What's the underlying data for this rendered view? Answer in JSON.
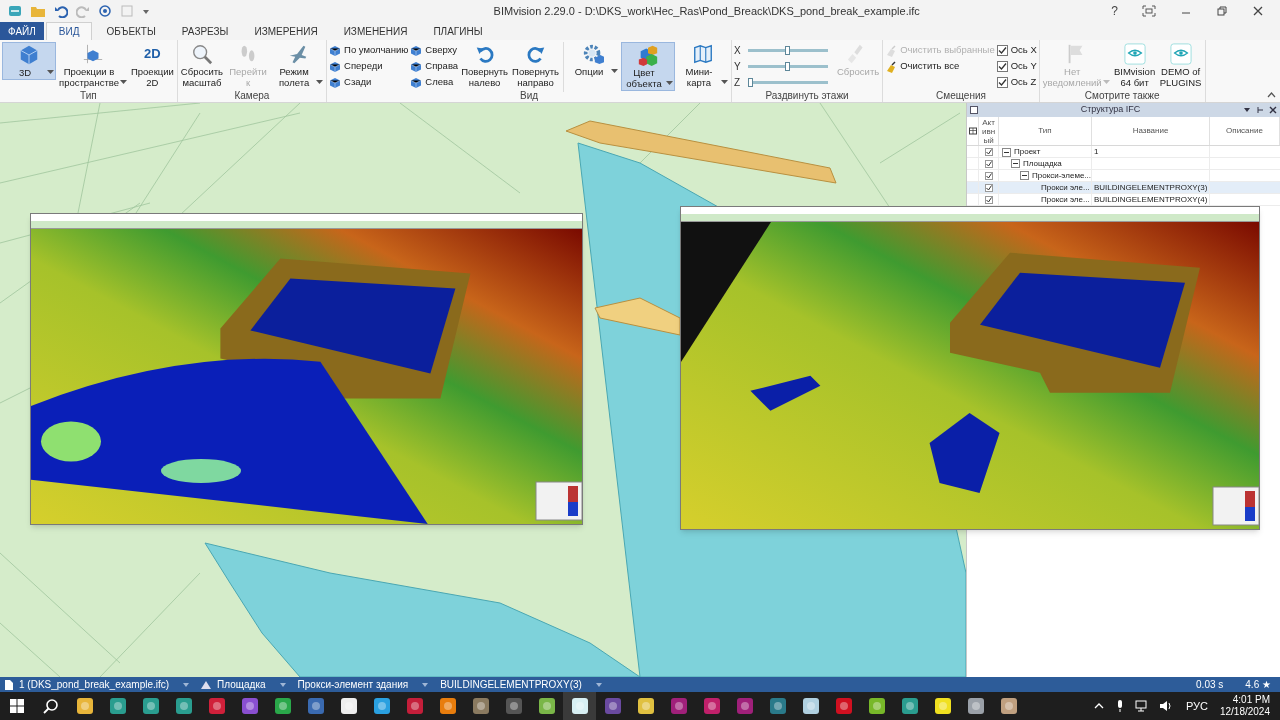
{
  "title_bar": {
    "title": "BIMvision 2.29.0 - D:\\DKS_work\\Hec_Ras\\Pond_Breack\\DKS_pond_break_example.ifc",
    "help": "?"
  },
  "ribbon": {
    "tabs": [
      {
        "label": "ФАЙЛ",
        "kind": "file",
        "selected": false
      },
      {
        "label": "ВИД",
        "kind": "tab",
        "selected": true
      },
      {
        "label": "ОБЪЕКТЫ",
        "kind": "tab",
        "selected": false
      },
      {
        "label": "РАЗРЕЗЫ",
        "kind": "tab",
        "selected": false
      },
      {
        "label": "ИЗМЕРЕНИЯ",
        "kind": "tab",
        "selected": false
      },
      {
        "label": "ИЗМЕНЕНИЯ",
        "kind": "tab",
        "selected": false
      },
      {
        "label": "ПЛАГИНЫ",
        "kind": "tab",
        "selected": false
      }
    ],
    "groups": [
      {
        "label": "Тип",
        "items": [
          {
            "kind": "large",
            "label": "3D",
            "dropdown": true,
            "selected": true,
            "disabled": false
          },
          {
            "kind": "large",
            "label": "Проекции в пространстве",
            "dropdown": true,
            "selected": false,
            "disabled": false
          },
          {
            "kind": "large",
            "label": "Проекции 2D",
            "icon_text": "2D",
            "dropdown": false,
            "selected": false,
            "disabled": false
          }
        ]
      },
      {
        "label": "Камера",
        "items": [
          {
            "kind": "large",
            "label": "Сбросить масштаб",
            "dropdown": false,
            "selected": false,
            "disabled": false
          },
          {
            "kind": "large",
            "label": "Перейти к",
            "dropdown": false,
            "selected": false,
            "disabled": true
          },
          {
            "kind": "large",
            "label": "Режим полета",
            "dropdown": true,
            "selected": false,
            "disabled": false
          }
        ]
      },
      {
        "label": "Вид",
        "items": [
          {
            "kind": "stack",
            "items": [
              {
                "kind": "small",
                "label": "По умолчанию",
                "disabled": false
              },
              {
                "kind": "small",
                "label": "Спереди",
                "disabled": false
              },
              {
                "kind": "small",
                "label": "Сзади",
                "disabled": false
              }
            ]
          },
          {
            "kind": "stack",
            "items": [
              {
                "kind": "small",
                "label": "Сверху",
                "disabled": false
              },
              {
                "kind": "small",
                "label": "Справа",
                "disabled": false
              },
              {
                "kind": "small",
                "label": "Слева",
                "disabled": false
              }
            ]
          },
          {
            "kind": "large",
            "label": "Повернуть налево",
            "dropdown": false,
            "selected": false,
            "disabled": false
          },
          {
            "kind": "large",
            "label": "Повернуть направо",
            "dropdown": false,
            "selected": false,
            "disabled": false
          },
          {
            "kind": "separator"
          },
          {
            "kind": "large",
            "label": "Опции",
            "dropdown": true,
            "selected": false,
            "disabled": false
          },
          {
            "kind": "large",
            "label": "Цвет объекта",
            "dropdown": true,
            "selected": true,
            "disabled": false
          },
          {
            "kind": "large",
            "label": "Мини-карта",
            "dropdown": true,
            "selected": false,
            "disabled": false
          }
        ]
      },
      {
        "label": "Раздвинуть этажи",
        "items": [
          {
            "kind": "stack",
            "items": [
              {
                "kind": "slider",
                "label": "X",
                "level": 0.5
              },
              {
                "kind": "slider",
                "label": "Y",
                "level": 0.5
              },
              {
                "kind": "slider",
                "label": "Z",
                "level": 0.0
              }
            ]
          },
          {
            "kind": "large",
            "label": "Сбросить",
            "dropdown": false,
            "selected": false,
            "disabled": true
          }
        ]
      },
      {
        "label": "Смещения",
        "items": [
          {
            "kind": "stack",
            "items": [
              {
                "kind": "small",
                "label": "Очистить выбранные",
                "disabled": true
              },
              {
                "kind": "small",
                "label": "Очистить все",
                "disabled": false
              }
            ]
          },
          {
            "kind": "stack",
            "items": [
              {
                "kind": "checkbox",
                "label": "Ось X",
                "checked": true
              },
              {
                "kind": "checkbox",
                "label": "Ось Y",
                "checked": true
              },
              {
                "kind": "checkbox",
                "label": "Ось Z",
                "checked": true
              }
            ]
          }
        ]
      },
      {
        "label": "Смотрите также",
        "items": [
          {
            "kind": "large",
            "label": "Нет уведомлений",
            "dropdown": true,
            "selected": false,
            "disabled": true
          },
          {
            "kind": "large",
            "label": "BIMvision 64 бит",
            "dropdown": false,
            "selected": false,
            "disabled": false
          },
          {
            "kind": "large",
            "label": "DEMO of PLUGINS",
            "dropdown": false,
            "selected": false,
            "disabled": false
          }
        ]
      }
    ]
  },
  "ifc_panel": {
    "title": "Структура IFC",
    "columns": [
      "Активный",
      "Тип",
      "Название",
      "Описание"
    ],
    "rows": [
      {
        "type": "Проект",
        "name": "1",
        "active": true,
        "expanded": true,
        "selected": false,
        "children": [
          {
            "type": "Площадка",
            "active": true,
            "expanded": true,
            "selected": false,
            "children": [
              {
                "type": "Прокси-элеме...",
                "active": true,
                "expanded": true,
                "selected": false,
                "children": [
                  {
                    "type": "Прокси эле...",
                    "name": "BUILDINGELEMENTPROXY(3)",
                    "active": true,
                    "selected": true
                  },
                  {
                    "type": "Прокси эле...",
                    "name": "BUILDINGELEMENTPROXY(4)",
                    "active": true,
                    "selected": false
                  }
                ]
              }
            ]
          }
        ]
      }
    ]
  },
  "status_bar": {
    "breadcrumbs": [
      "1 (DKS_pond_break_example.ifc)",
      "Площадка",
      "Прокси-элемент здания",
      "BUILDINGELEMENTPROXY(3)"
    ],
    "time": "0.03 s",
    "rating": "4.6 ★"
  },
  "taskbar": {
    "language": "РУС",
    "time": "4:01 PM",
    "date": "12/18/2024"
  }
}
